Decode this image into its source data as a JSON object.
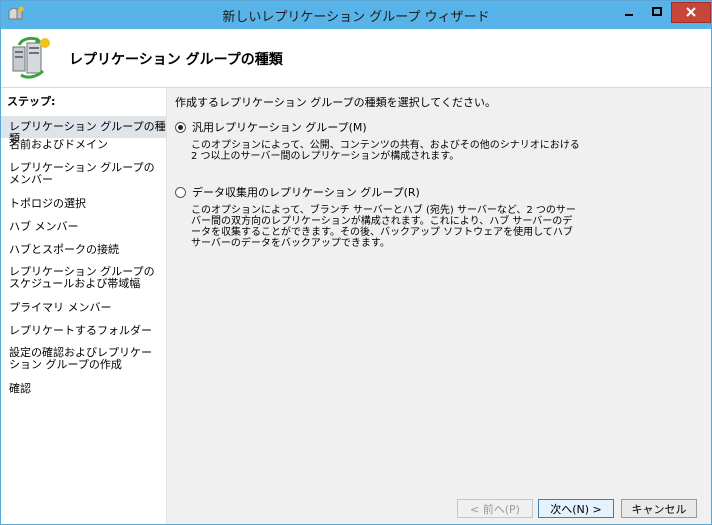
{
  "window": {
    "title": "新しいレプリケーション グループ ウィザード"
  },
  "header": {
    "title": "レプリケーション グループの種類"
  },
  "steps": {
    "heading": "ステップ:",
    "items": [
      {
        "label": "レプリケーション グループの種類",
        "active": true
      },
      {
        "label": "名前およびドメイン",
        "active": false
      },
      {
        "label": "レプリケーション グループのメンバー",
        "active": false
      },
      {
        "label": "トポロジの選択",
        "active": false
      },
      {
        "label": "ハブ メンバー",
        "active": false
      },
      {
        "label": "ハブとスポークの接続",
        "active": false
      },
      {
        "label": "レプリケーション グループのスケジュールおよび帯域幅",
        "active": false
      },
      {
        "label": "プライマリ メンバー",
        "active": false
      },
      {
        "label": "レプリケートするフォルダー",
        "active": false
      },
      {
        "label": "設定の確認およびレプリケーション グループの作成",
        "active": false
      },
      {
        "label": "確認",
        "active": false
      }
    ]
  },
  "main": {
    "instruction": "作成するレプリケーション グループの種類を選択してください。",
    "options": [
      {
        "label": "汎用レプリケーション グループ(M)",
        "selected": true,
        "description": "このオプションによって、公開、コンテンツの共有、およびその他のシナリオにおける 2 つ以上のサーバー間のレプリケーションが構成されます。"
      },
      {
        "label": "データ収集用のレプリケーション グループ(R)",
        "selected": false,
        "description": "このオプションによって、ブランチ サーバーとハブ (宛先) サーバーなど、2 つのサーバー間の双方向のレプリケーションが構成されます。これにより、ハブ サーバーのデータを収集することができます。その後、バックアップ ソフトウェアを使用してハブ サーバーのデータをバックアップできます。"
      }
    ]
  },
  "buttons": {
    "back": "< 前へ(P)",
    "next": "次へ(N) >",
    "cancel": "キャンセル"
  },
  "colors": {
    "titlebar": "#58b4e8",
    "close_button": "#c7463a",
    "step_active": "#dfe3ea",
    "content_background": "#f0f0f0"
  },
  "icons": {
    "app": "wizard-icon",
    "header": "server-replication-icon"
  }
}
